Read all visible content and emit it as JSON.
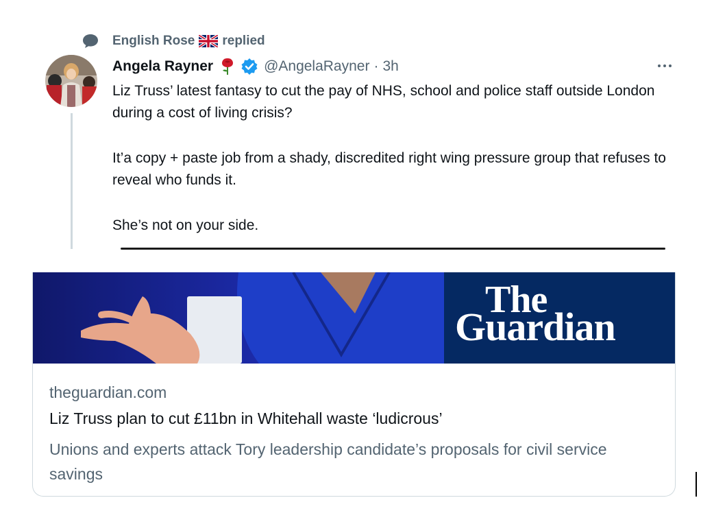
{
  "context": {
    "replier_name": "English Rose",
    "replied_label": "replied",
    "icon": "speech-bubble-icon",
    "flag_icon": "union-jack-flag-icon"
  },
  "tweet": {
    "author_name": "Angela Rayner",
    "author_handle": "@AngelaRayner",
    "separator": "·",
    "time": "3h",
    "rose_icon": "red-rose-icon",
    "verified_icon": "verified-badge-icon",
    "more_icon": "more-options-icon",
    "text_lines": {
      "p1": "Liz Truss’ latest fantasy to cut the pay of NHS, school and police staff outside London during a cost of living crisis?",
      "p2": "It’a copy + paste job from a shady, discredited right wing pressure group that refuses to reveal who funds it.",
      "p3": "She’s not on your side."
    }
  },
  "card": {
    "logo_line1": "The",
    "logo_line2": "Guardian",
    "domain": "theguardian.com",
    "title": "Liz Truss plan to cut £11bn in Whitehall waste ‘ludicrous’",
    "description": "Unions and experts attack Tory leadership candidate’s proposals for civil service savings"
  },
  "colors": {
    "text_primary": "#0f1419",
    "text_secondary": "#536471",
    "verified_blue": "#1d9bf0",
    "guardian_navy": "#052962",
    "border": "#cfd9de"
  }
}
